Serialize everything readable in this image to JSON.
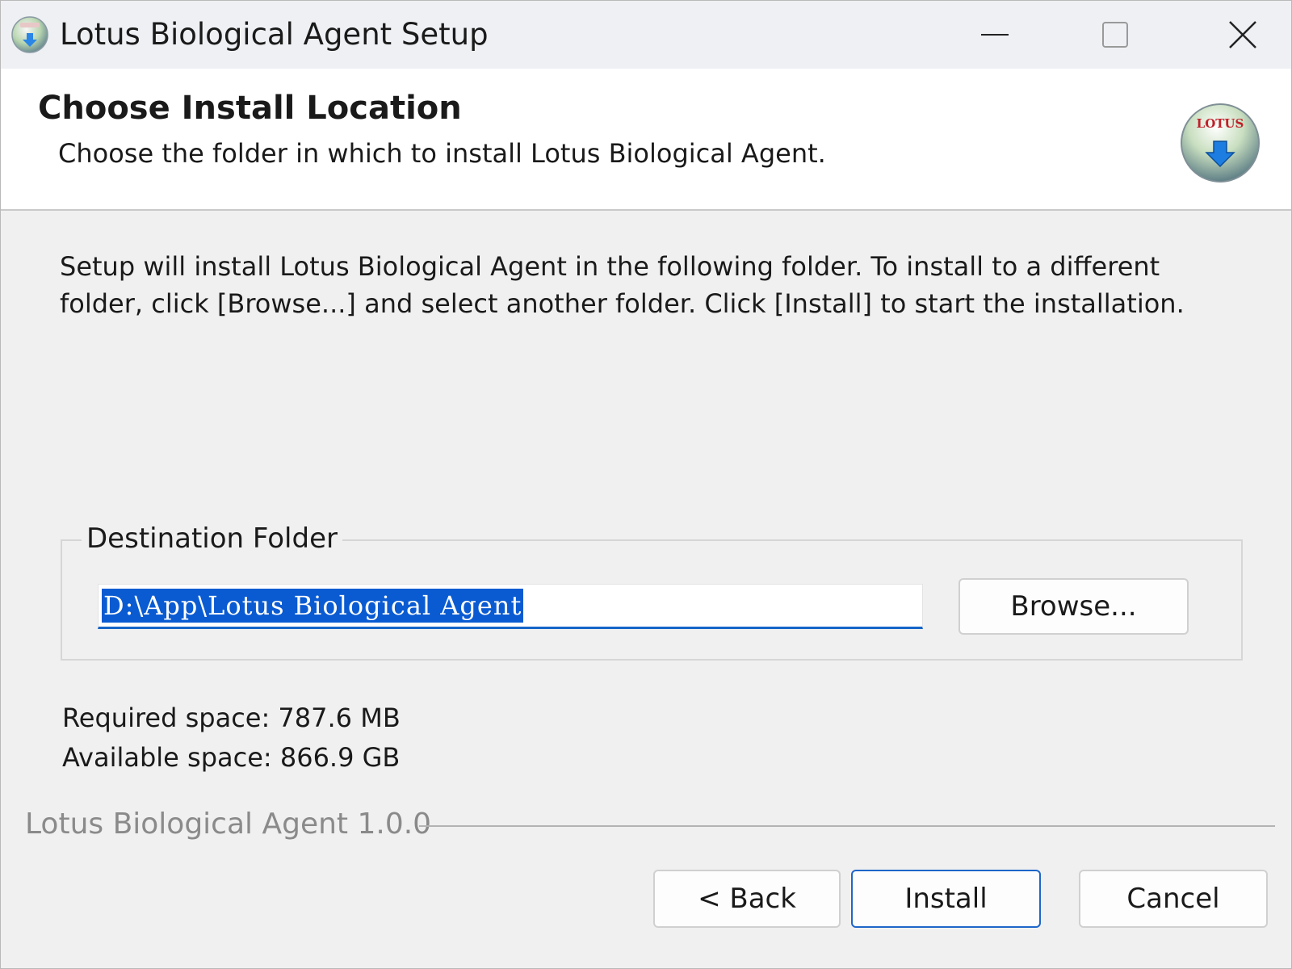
{
  "window": {
    "title": "Lotus Biological Agent Setup",
    "controls": [
      "minimize",
      "maximize",
      "close"
    ]
  },
  "header": {
    "title": "Choose Install Location",
    "subtitle": "Choose the folder in which to install Lotus Biological Agent.",
    "logo_text": "LOTUS"
  },
  "body": {
    "description": "Setup will install Lotus Biological Agent in the following folder. To install to a different folder, click [Browse...] and select another folder. Click [Install] to start the installation.",
    "destination": {
      "legend": "Destination Folder",
      "path": "D:\\App\\Lotus Biological Agent",
      "browse_label": "Browse..."
    },
    "required_space": "Required space: 787.6 MB",
    "available_space": "Available space: 866.9 GB"
  },
  "footer": {
    "branding": "Lotus Biological Agent 1.0.0",
    "back_label": "< Back",
    "install_label": "Install",
    "cancel_label": "Cancel"
  },
  "colors": {
    "selection": "#0a5bd2",
    "focus_border": "#1e66c9",
    "logo_red": "#c0202a",
    "arrow_blue": "#1e7de0"
  }
}
